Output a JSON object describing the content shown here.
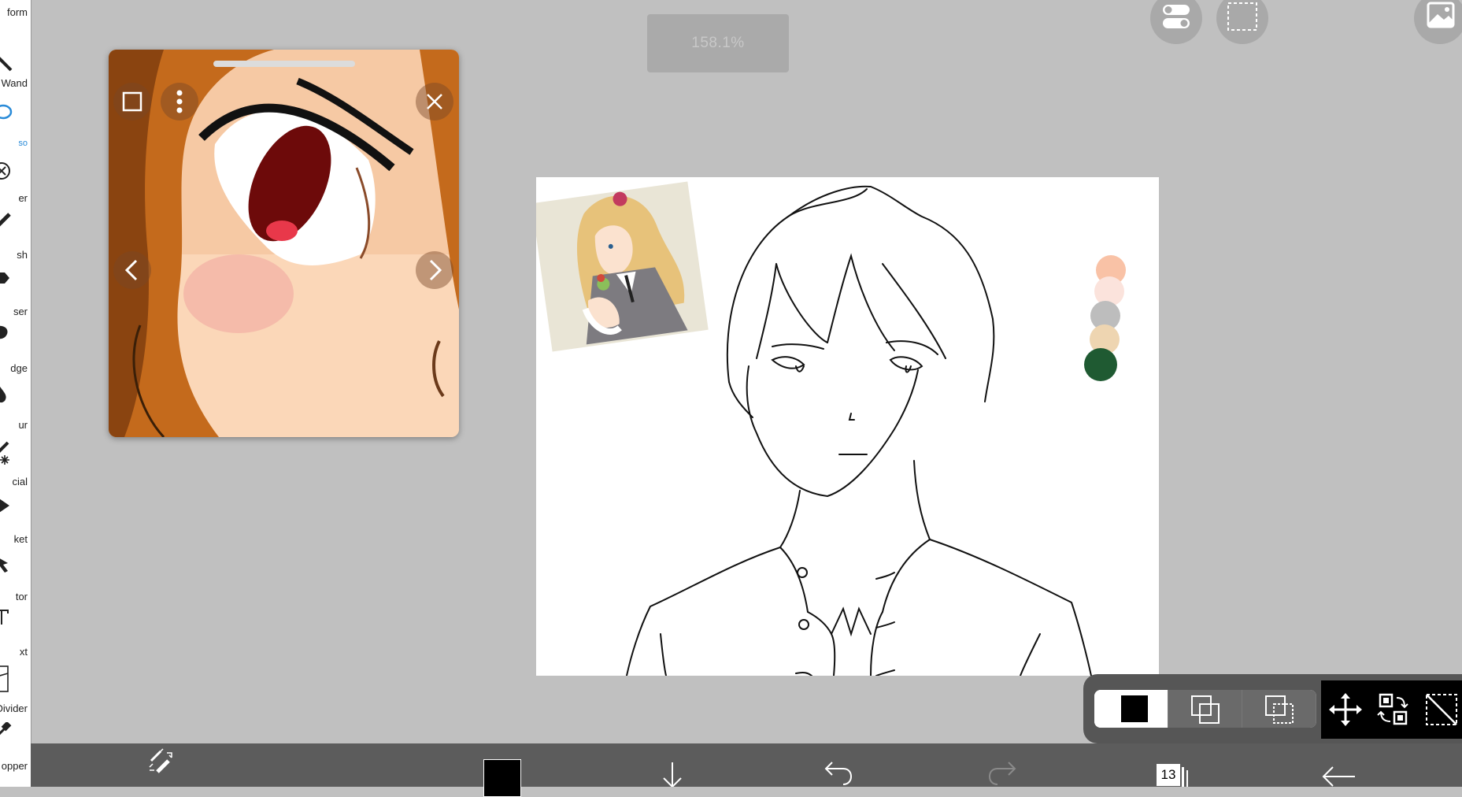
{
  "toolbar": {
    "tools": [
      {
        "label": "form",
        "icon": "transform-icon"
      },
      {
        "label": "Wand",
        "icon": "magic-wand-icon"
      },
      {
        "label": "so",
        "icon": "lasso-icon",
        "active": true
      },
      {
        "label": "er",
        "icon": "filter-icon"
      },
      {
        "label": "sh",
        "icon": "brush-icon"
      },
      {
        "label": "ser",
        "icon": "eraser-icon"
      },
      {
        "label": "dge",
        "icon": "smudge-icon"
      },
      {
        "label": "ur",
        "icon": "blur-icon"
      },
      {
        "label": "cial",
        "icon": "special-icon"
      },
      {
        "label": "ket",
        "icon": "bucket-icon"
      },
      {
        "label": "tor",
        "icon": "selector-icon"
      },
      {
        "label": "xt",
        "icon": "text-icon"
      },
      {
        "label": "Divider",
        "icon": "frame-divider-icon"
      },
      {
        "label": "opper",
        "icon": "eyedropper-icon"
      }
    ]
  },
  "zoom": {
    "level": "158.1%"
  },
  "reference_window": {
    "buttons": [
      "square-icon",
      "more-vertical-icon",
      "close-icon",
      "chevron-left-icon",
      "chevron-right-icon"
    ]
  },
  "palette": {
    "colors": [
      "#f9c2a6",
      "#fbe3dc",
      "#bdbdbd",
      "#eed5b1",
      "#1f5a32"
    ]
  },
  "selection_panel": {
    "modes": [
      "fill-black-icon",
      "add-selection-icon",
      "subtract-selection-icon"
    ],
    "actions": [
      "move-icon",
      "transform-icon",
      "deselect-icon"
    ]
  },
  "bottom_bar": {
    "layer_count": "13",
    "primary_color": "#000000"
  },
  "colors": {
    "background": "#c0c0c0",
    "accent": "#2a8bd8",
    "panel": "#565656"
  }
}
